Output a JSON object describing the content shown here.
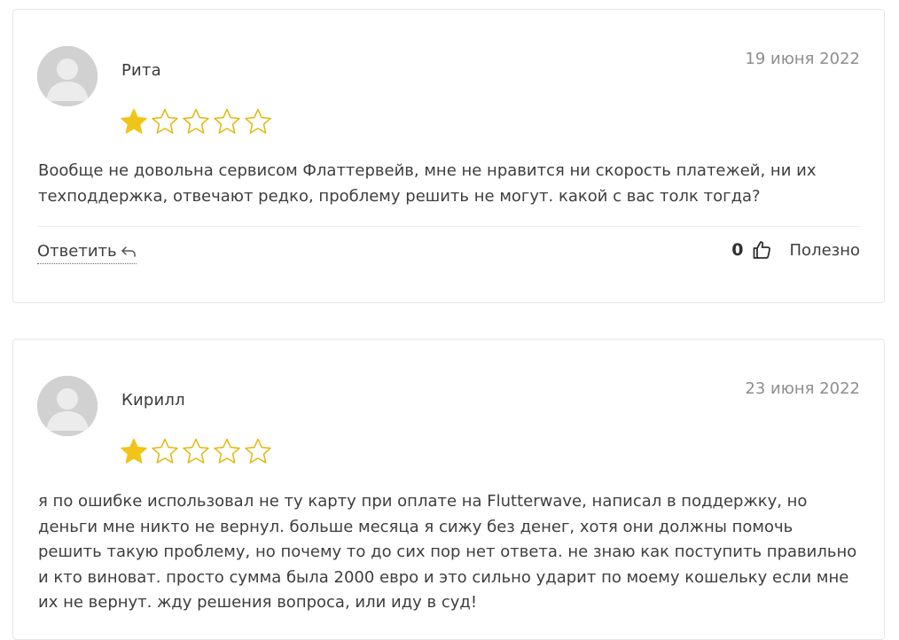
{
  "reviews": [
    {
      "author": "Рита",
      "date": "19 июня 2022",
      "rating": 1,
      "max_rating": 5,
      "text": "Вообще не довольна сервисом Флаттервейв, мне не нравится ни скорость платежей, ни их техподдержка, отвечают редко, проблему решить не могут. какой с вас толк тогда?",
      "reply_label": "Ответить",
      "helpful_count": "0",
      "helpful_label": "Полезно"
    },
    {
      "author": "Кирилл",
      "date": "23 июня 2022",
      "rating": 1,
      "max_rating": 5,
      "text": "я по ошибке использовал не ту карту при оплате на Flutterwave, написал в поддержку, но деньги мне никто не вернул. больше месяца я сижу без денег, хотя они должны помочь решить такую проблему, но почему то до сих пор нет ответа. не знаю как поступить правильно и кто виноват. просто сумма была 2000 евро и это сильно ударит по моему кошельку если мне их не вернут. жду решения вопроса, или иду в суд!"
    }
  ],
  "colors": {
    "star_filled": "#f0c419",
    "star_outline": "#e2b70f",
    "avatar_bg": "#d0d0d0"
  },
  "icons": {
    "avatar": "user-avatar-icon",
    "star": "star-icon",
    "reply": "reply-arrow-icon",
    "like": "thumbs-up-icon"
  }
}
